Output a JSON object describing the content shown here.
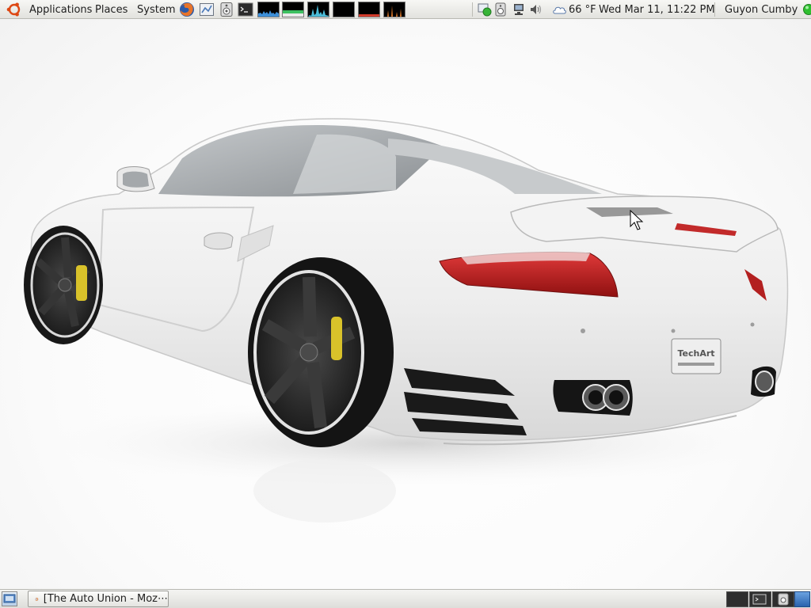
{
  "top_panel": {
    "menus": {
      "applications": "Applications",
      "places": "Places",
      "system": "System"
    },
    "launchers": [
      "firefox-icon",
      "network-icon",
      "speaker-app-icon",
      "terminal-icon"
    ],
    "system_monitors": [
      {
        "name": "cpu-monitor",
        "color": "#3d8fd8"
      },
      {
        "name": "memory-monitor",
        "color": "#3dc060"
      },
      {
        "name": "network-monitor",
        "color": "#4bbcd8"
      },
      {
        "name": "swap-monitor",
        "color": "#000000"
      },
      {
        "name": "load-monitor",
        "color": "#d23c2c"
      },
      {
        "name": "disk-monitor",
        "color": "#e07a2a"
      }
    ],
    "tray_icons": [
      "network-manager-icon",
      "update-notifier-icon",
      "network-status-icon",
      "volume-icon"
    ],
    "weather": {
      "icon": "cloud-icon",
      "temperature": "66 °F"
    },
    "clock": "Wed Mar 11, 11:22 PM",
    "user": {
      "name": "Guyon Cumby",
      "status_color": "#2fbf2f"
    }
  },
  "desktop": {
    "wallpaper": "white-porsche-911-turbo",
    "license_plate": "TechArt",
    "colors": {
      "car_body": "#f4f4f4",
      "taillight": "#c41e1e",
      "wheel": "#2a2a2a",
      "brake_caliper": "#d9c22a"
    }
  },
  "bottom_panel": {
    "task": {
      "icon": "firefox-icon",
      "label": "[The Auto Union - Moz⋯"
    },
    "workspaces": [
      "workspace-1",
      "workspace-2",
      "workspace-3",
      "workspace-4"
    ]
  }
}
